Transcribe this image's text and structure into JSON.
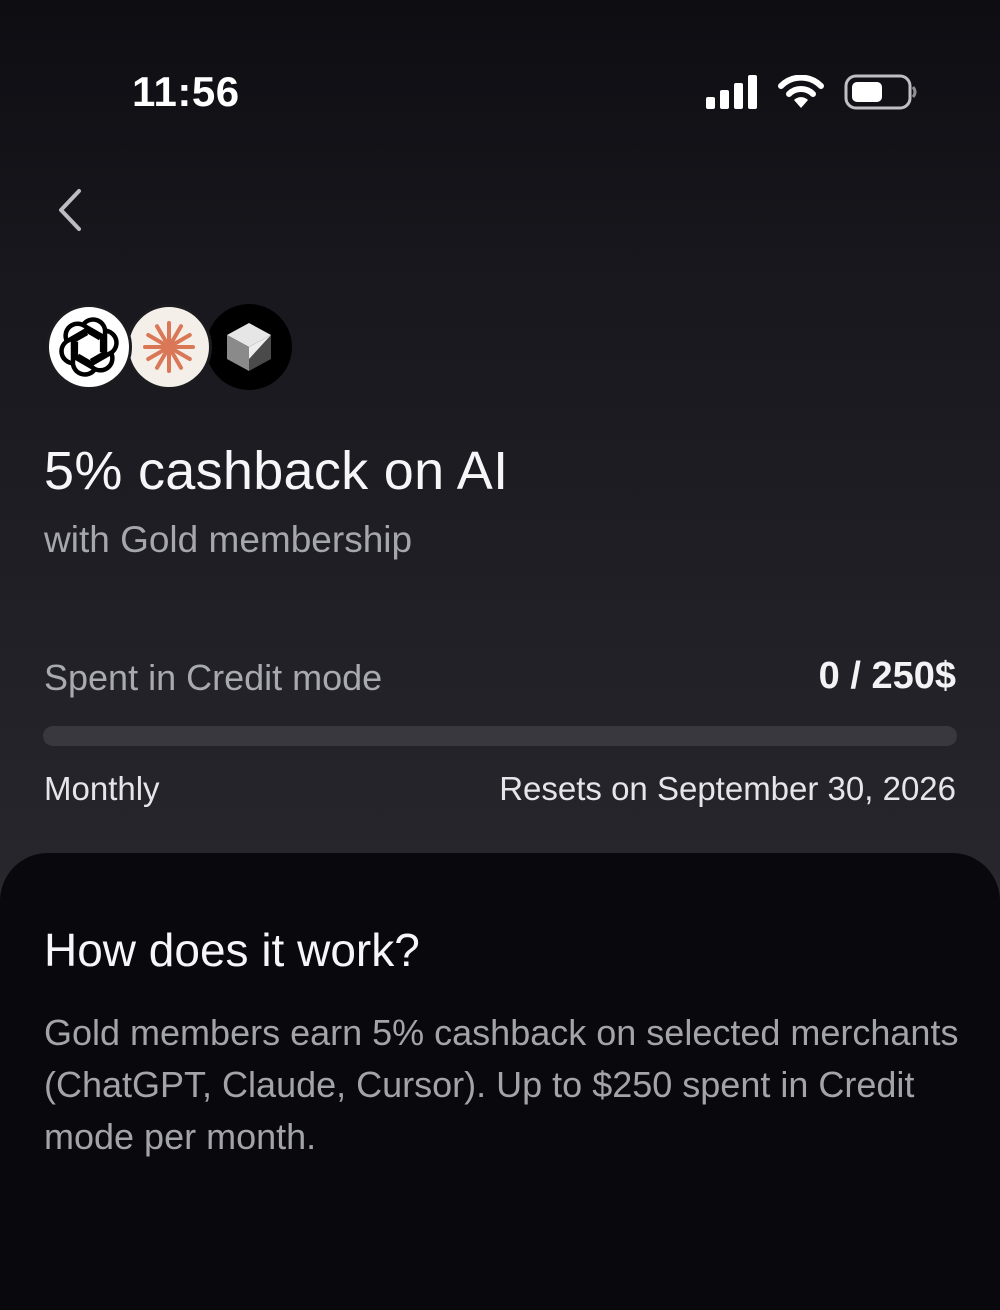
{
  "status_bar": {
    "time": "11:56",
    "icons": [
      "cellular-signal-icon",
      "wifi-icon",
      "battery-icon"
    ]
  },
  "header": {
    "back_icon": "chevron-left-icon"
  },
  "merchants": [
    {
      "name": "ChatGPT",
      "icon": "openai-logo-icon"
    },
    {
      "name": "Claude",
      "icon": "claude-logo-icon"
    },
    {
      "name": "Cursor",
      "icon": "cursor-logo-icon"
    }
  ],
  "offer": {
    "title": "5% cashback on AI",
    "subtitle": "with Gold membership"
  },
  "usage": {
    "label": "Spent in Credit mode",
    "value_text": "0 / 250$",
    "spent": 0,
    "limit": 250,
    "progress_fraction": 0,
    "period": "Monthly",
    "resets_text": "Resets on September 30, 2026"
  },
  "info": {
    "title": "How does it work?",
    "body": "Gold members earn 5% cashback on selected merchants (ChatGPT, Claude, Cursor). Up to $250 spent in Credit mode per month."
  },
  "colors": {
    "background_top": "#0d0d12",
    "background_bottom": "#2a2a30",
    "sheet": "#09080d",
    "progress_track": "#38383e",
    "claude_accent": "#d97757"
  }
}
